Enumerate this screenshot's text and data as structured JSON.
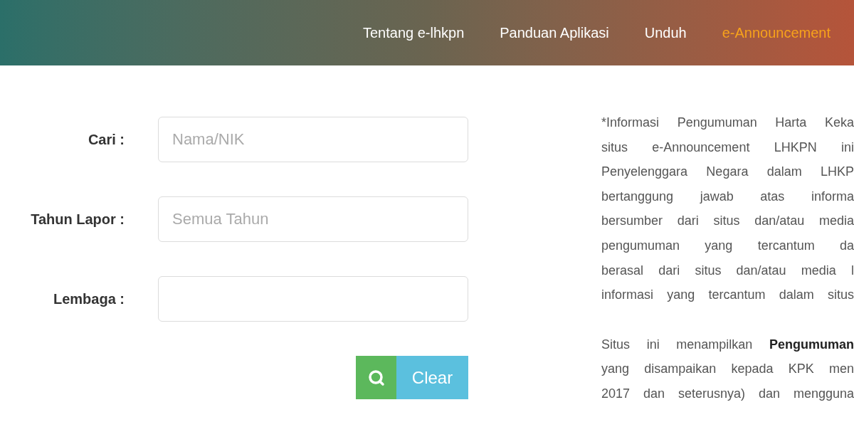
{
  "nav": {
    "items": [
      {
        "label": "Tentang e-lhkpn",
        "selected": false
      },
      {
        "label": "Panduan Aplikasi",
        "selected": false
      },
      {
        "label": "Unduh",
        "selected": false
      },
      {
        "label": "e-Announcement",
        "selected": true
      }
    ]
  },
  "search_form": {
    "fields": [
      {
        "label": "Cari :",
        "placeholder": "Nama/NIK"
      },
      {
        "label": "Tahun Lapor :",
        "placeholder": "Semua Tahun"
      },
      {
        "label": "Lembaga :"
      }
    ],
    "buttons": [
      {
        "kind": "search"
      },
      {
        "kind": "clear",
        "label": "Clear"
      }
    ]
  },
  "notice": {
    "paragraphs": [
      {
        "lines": [
          "*Informasi Pengumuman Harta Keka",
          "situs e-Announcement LHKPN ini",
          "Penyelenggara Negara dalam LHKP",
          "bertanggung jawab atas informa",
          "bersumber dari situs dan/atau media",
          "pengumuman yang tercantum da",
          "berasal dari situs dan/atau media l",
          "informasi yang tercantum dalam situs"
        ]
      },
      {
        "lines": [
          "Situs ini menampilkan **Pengumuman**",
          "yang disampaikan kepada KPK men",
          "2017 dan seterusnya) dan mengguna"
        ]
      }
    ]
  }
}
